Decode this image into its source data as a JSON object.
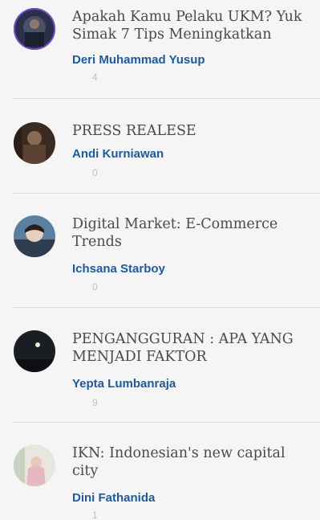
{
  "articles": [
    {
      "title": "Apakah Kamu Pelaku UKM? Yuk Simak 7 Tips Meningkatkan",
      "author": "Deri Muhammad Yusup",
      "count": "4"
    },
    {
      "title": "PRESS REALESE",
      "author": "Andi Kurniawan",
      "count": "0"
    },
    {
      "title": "Digital Market: E-Commerce Trends",
      "author": "Ichsana Starboy",
      "count": "0"
    },
    {
      "title": "PENGANGGURAN : APA YANG MENJADI FAKTOR",
      "author": "Yepta Lumbanraja",
      "count": "9"
    },
    {
      "title": "IKN: Indonesian's new capital city",
      "author": "Dini Fathanida",
      "count": "1"
    }
  ]
}
